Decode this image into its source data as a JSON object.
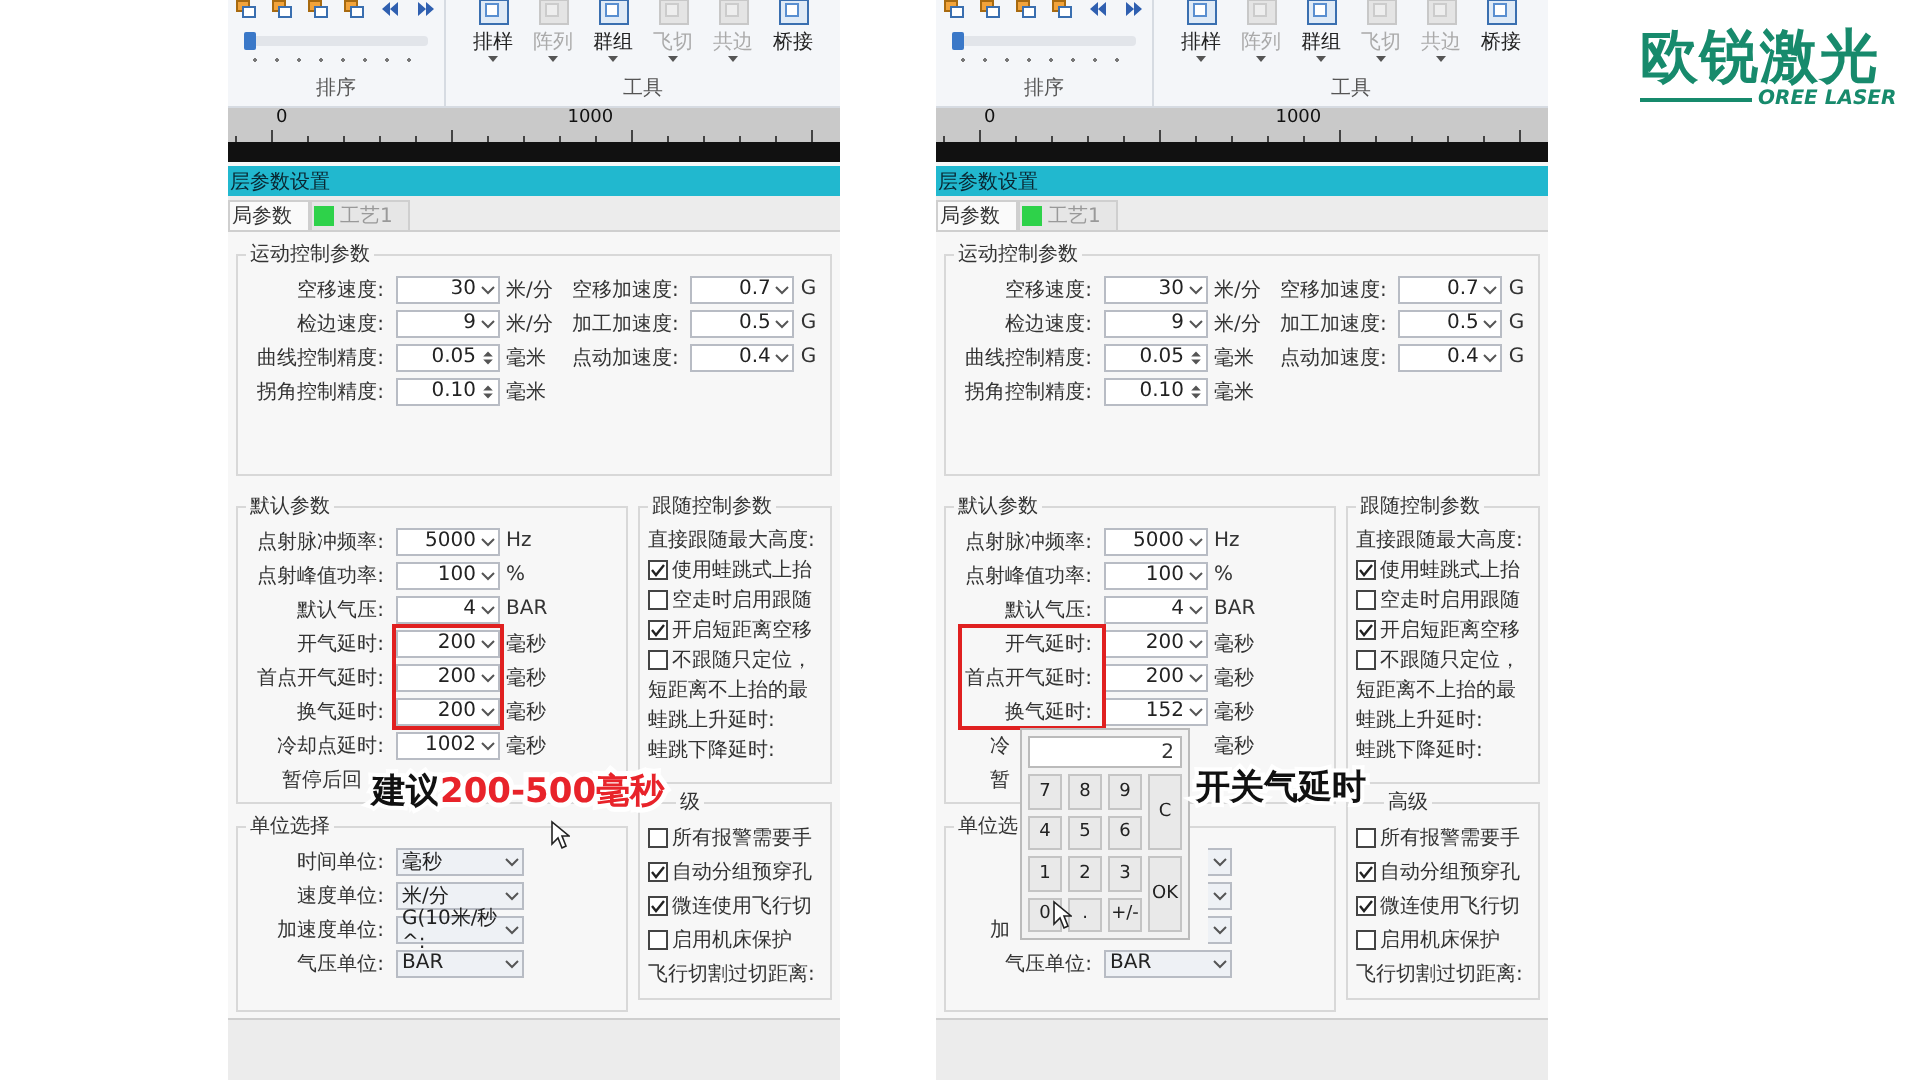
{
  "panels": [
    {
      "ribbon": {
        "icons_label": "排序",
        "tools_label": "工具",
        "slider": {
          "level": 0
        },
        "tools": [
          {
            "label": "排样",
            "disabled": false,
            "dropdown": true
          },
          {
            "label": "阵列",
            "disabled": true,
            "dropdown": true
          },
          {
            "label": "群组",
            "disabled": false,
            "dropdown": true
          },
          {
            "label": "飞切",
            "disabled": true,
            "dropdown": true
          },
          {
            "label": "共边",
            "disabled": true,
            "dropdown": true
          },
          {
            "label": "桥接",
            "disabled": false,
            "dropdown": false
          }
        ]
      },
      "ruler": [
        "0",
        "1000"
      ],
      "dialog_title": "层参数设置",
      "tabs": [
        {
          "label": "局参数",
          "selected": true
        },
        {
          "label": "工艺1",
          "selected": false
        }
      ],
      "motion": {
        "title": "运动控制参数",
        "left": [
          {
            "label": "空移速度:",
            "value": "30",
            "kind": "combo",
            "unit": "米/分"
          },
          {
            "label": "检边速度:",
            "value": "9",
            "kind": "combo",
            "unit": "米/分"
          },
          {
            "label": "曲线控制精度:",
            "value": "0.05",
            "kind": "spin",
            "unit": "毫米"
          },
          {
            "label": "拐角控制精度:",
            "value": "0.10",
            "kind": "spin",
            "unit": "毫米"
          }
        ],
        "right": [
          {
            "label": "空移加速度:",
            "value": "0.7",
            "kind": "combo",
            "unit": "G"
          },
          {
            "label": "加工加速度:",
            "value": "0.5",
            "kind": "combo",
            "unit": "G"
          },
          {
            "label": "点动加速度:",
            "value": "0.4",
            "kind": "combo",
            "unit": "G"
          }
        ]
      },
      "defaults": {
        "title": "默认参数",
        "rows_before": [
          {
            "label": "点射脉冲频率:",
            "value": "5000",
            "kind": "combo",
            "unit": "Hz"
          },
          {
            "label": "点射峰值功率:",
            "value": "100",
            "kind": "combo",
            "unit": "%"
          },
          {
            "label": "默认气压:",
            "value": "4",
            "kind": "combo",
            "unit": "BAR"
          }
        ],
        "highlighted_rows": {
          "kind": "fields",
          "rows": [
            {
              "label": "开气延时:",
              "value": "200",
              "kind": "combo",
              "unit": "毫秒"
            },
            {
              "label": "首点开气延时:",
              "value": "200",
              "kind": "combo",
              "unit": "毫秒"
            },
            {
              "label": "换气延时:",
              "value": "200",
              "kind": "combo",
              "unit": "毫秒"
            }
          ]
        },
        "rows_after": [
          {
            "label": "冷却点延时:",
            "value": "1002",
            "kind": "combo",
            "unit": "毫秒"
          },
          {
            "label": "暂停后回",
            "kind": "covered"
          }
        ]
      },
      "units": {
        "title": "单位选择",
        "rows": [
          {
            "label": "时间单位:",
            "value": "毫秒",
            "kind": "select"
          },
          {
            "label": "速度单位:",
            "value": "米/分",
            "kind": "select"
          },
          {
            "label": "加速度单位:",
            "value": "G(10米/秒^:",
            "kind": "select"
          },
          {
            "label": "气压单位:",
            "value": "BAR",
            "kind": "select"
          }
        ]
      },
      "follow": {
        "title": "跟随控制参数",
        "items": [
          {
            "kind": "text",
            "label": "直接跟随最大高度:"
          },
          {
            "kind": "check",
            "label": "使用蛙跳式上抬",
            "checked": true
          },
          {
            "kind": "check",
            "label": "空走时启用跟随",
            "checked": false
          },
          {
            "kind": "check",
            "label": "开启短距离空移",
            "checked": true
          },
          {
            "kind": "check",
            "label": "不跟随只定位，",
            "checked": false
          },
          {
            "kind": "text",
            "label": "短距离不上抬的最"
          },
          {
            "kind": "text",
            "label": "蛙跳上升延时:"
          },
          {
            "kind": "text",
            "label": "蛙跳下降延时:"
          }
        ]
      },
      "advanced": {
        "title": "级",
        "items": [
          {
            "kind": "check",
            "label": "所有报警需要手",
            "checked": false
          },
          {
            "kind": "check",
            "label": "自动分组预穿孔",
            "checked": true
          },
          {
            "kind": "check",
            "label": "微连使用飞行切",
            "checked": true
          },
          {
            "kind": "check",
            "label": "启用机床保护",
            "checked": false
          },
          {
            "kind": "text",
            "label": "飞行切割过切距离:"
          }
        ]
      },
      "caption": {
        "lead": "建议",
        "emphasis": "200-500毫秒"
      }
    },
    {
      "ribbon": {
        "icons_label": "排序",
        "tools_label": "工具",
        "slider": {
          "level": 0
        },
        "tools": [
          {
            "label": "排样",
            "disabled": false,
            "dropdown": true
          },
          {
            "label": "阵列",
            "disabled": true,
            "dropdown": true
          },
          {
            "label": "群组",
            "disabled": false,
            "dropdown": true
          },
          {
            "label": "飞切",
            "disabled": true,
            "dropdown": true
          },
          {
            "label": "共边",
            "disabled": true,
            "dropdown": true
          },
          {
            "label": "桥接",
            "disabled": false,
            "dropdown": false
          }
        ]
      },
      "ruler": [
        "0",
        "1000"
      ],
      "dialog_title": "层参数设置",
      "tabs": [
        {
          "label": "局参数",
          "selected": true
        },
        {
          "label": "工艺1",
          "selected": false
        }
      ],
      "motion": {
        "title": "运动控制参数",
        "left": [
          {
            "label": "空移速度:",
            "value": "30",
            "kind": "combo",
            "unit": "米/分"
          },
          {
            "label": "检边速度:",
            "value": "9",
            "kind": "combo",
            "unit": "米/分"
          },
          {
            "label": "曲线控制精度:",
            "value": "0.05",
            "kind": "spin",
            "unit": "毫米"
          },
          {
            "label": "拐角控制精度:",
            "value": "0.10",
            "kind": "spin",
            "unit": "毫米"
          }
        ],
        "right": [
          {
            "label": "空移加速度:",
            "value": "0.7",
            "kind": "combo",
            "unit": "G"
          },
          {
            "label": "加工加速度:",
            "value": "0.5",
            "kind": "combo",
            "unit": "G"
          },
          {
            "label": "点动加速度:",
            "value": "0.4",
            "kind": "combo",
            "unit": "G"
          }
        ]
      },
      "defaults": {
        "title": "默认参数",
        "rows_before": [
          {
            "label": "点射脉冲频率:",
            "value": "5000",
            "kind": "combo",
            "unit": "Hz"
          },
          {
            "label": "点射峰值功率:",
            "value": "100",
            "kind": "combo",
            "unit": "%"
          },
          {
            "label": "默认气压:",
            "value": "4",
            "kind": "combo",
            "unit": "BAR"
          }
        ],
        "highlighted_rows": {
          "kind": "labels",
          "rows": [
            {
              "label": "开气延时:",
              "value": "200",
              "kind": "combo",
              "unit": "毫秒"
            },
            {
              "label": "首点开气延时:",
              "value": "200",
              "kind": "combo",
              "unit": "毫秒"
            },
            {
              "label": "换气延时:",
              "value": "152",
              "kind": "combo",
              "unit": "毫秒"
            }
          ]
        },
        "rows_after": [
          {
            "label": "冷",
            "kind": "covered",
            "unit": "毫秒"
          },
          {
            "label": "暂",
            "kind": "covered"
          }
        ]
      },
      "units": {
        "title": "单位选",
        "rows": [
          {
            "kind": "covered-select"
          },
          {
            "kind": "covered-select"
          },
          {
            "label": "加",
            "kind": "covered-select"
          },
          {
            "label": "气压单位:",
            "value": "BAR",
            "kind": "select"
          }
        ]
      },
      "follow": {
        "title": "跟随控制参数",
        "items": [
          {
            "kind": "text",
            "label": "直接跟随最大高度:"
          },
          {
            "kind": "check",
            "label": "使用蛙跳式上抬",
            "checked": true
          },
          {
            "kind": "check",
            "label": "空走时启用跟随",
            "checked": false
          },
          {
            "kind": "check",
            "label": "开启短距离空移",
            "checked": true
          },
          {
            "kind": "check",
            "label": "不跟随只定位，",
            "checked": false
          },
          {
            "kind": "text",
            "label": "短距离不上抬的最"
          },
          {
            "kind": "text",
            "label": "蛙跳上升延时:"
          },
          {
            "kind": "text",
            "label": "蛙跳下降延时:"
          }
        ]
      },
      "advanced": {
        "title": "高级",
        "items": [
          {
            "kind": "check",
            "label": "所有报警需要手",
            "checked": false
          },
          {
            "kind": "check",
            "label": "自动分组预穿孔",
            "checked": true
          },
          {
            "kind": "check",
            "label": "微连使用飞行切",
            "checked": true
          },
          {
            "kind": "check",
            "label": "启用机床保护",
            "checked": false
          },
          {
            "kind": "text",
            "label": "飞行切割过切距离:"
          }
        ]
      },
      "keypad": {
        "display": "2",
        "keys": [
          {
            "label": "7",
            "kind": "key"
          },
          {
            "label": "8",
            "kind": "key"
          },
          {
            "label": "9",
            "kind": "key"
          },
          {
            "label": "C",
            "kind": "tall"
          },
          {
            "label": "4",
            "kind": "key"
          },
          {
            "label": "5",
            "kind": "key"
          },
          {
            "label": "6",
            "kind": "key"
          },
          {
            "label": "1",
            "kind": "key"
          },
          {
            "label": "2",
            "kind": "key"
          },
          {
            "label": "3",
            "kind": "key"
          },
          {
            "label": "OK",
            "kind": "tall"
          },
          {
            "label": "0",
            "kind": "key"
          },
          {
            "label": ".",
            "kind": "key"
          },
          {
            "label": "+/-",
            "kind": "key"
          }
        ]
      },
      "caption": {
        "lead": "开关气延时"
      }
    }
  ],
  "logo": {
    "name": "欧锐激光",
    "tagline": "OREE LASER"
  }
}
